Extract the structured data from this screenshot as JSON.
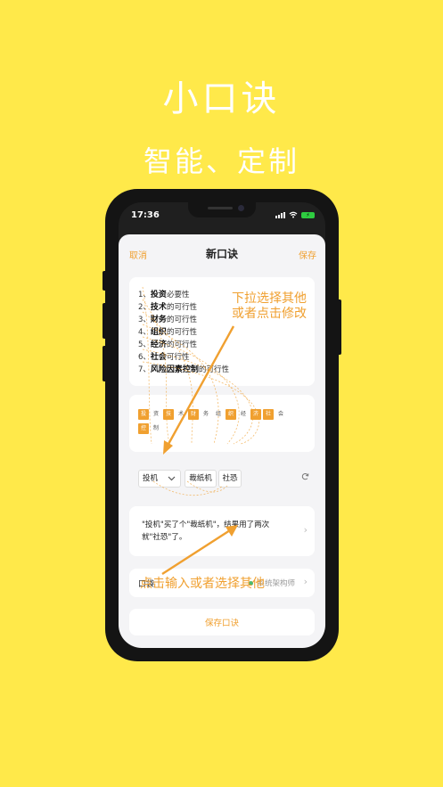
{
  "promo": {
    "title": "小口诀",
    "subtitle": "智能、定制"
  },
  "status_bar": {
    "time": "17:36",
    "battery_icon": "battery-charging-icon"
  },
  "nav": {
    "cancel": "取消",
    "title": "新口诀",
    "save": "保存"
  },
  "items": [
    {
      "num": "1、",
      "bold": "投资",
      "rest": "必要性"
    },
    {
      "num": "2、",
      "bold": "技术",
      "rest": "的可行性"
    },
    {
      "num": "3、",
      "bold": "财务",
      "rest": "的可行性"
    },
    {
      "num": "4、",
      "bold": "组织",
      "rest": "的可行性"
    },
    {
      "num": "5、",
      "bold": "经济",
      "rest": "的可行性"
    },
    {
      "num": "6、",
      "bold": "社会",
      "rest": "可行性"
    },
    {
      "num": "7、",
      "bold": "风险因素控制",
      "rest": "的可行性"
    }
  ],
  "chips": {
    "row1": [
      {
        "ch": "投",
        "on": true
      },
      {
        "ch": "资",
        "on": false
      },
      {
        "ch": "技",
        "on": true
      },
      {
        "ch": "术",
        "on": false
      },
      {
        "ch": "财",
        "on": true
      },
      {
        "ch": "务",
        "on": false
      },
      {
        "ch": "组",
        "on": false
      },
      {
        "ch": "织",
        "on": true
      },
      {
        "ch": "经",
        "on": false
      },
      {
        "ch": "济",
        "on": true
      },
      {
        "ch": "社",
        "on": true
      },
      {
        "ch": "会",
        "on": false
      }
    ],
    "row2": [
      {
        "ch": "控",
        "on": true
      },
      {
        "ch": "制",
        "on": false
      }
    ]
  },
  "slots": {
    "first": "投机",
    "second": "裁纸机",
    "third": "社恐"
  },
  "sentence": {
    "line1": "\"投机\"买了个\"裁纸机\"，结果用了两次",
    "line2": "就\"社恐\"了。"
  },
  "pocket": {
    "label": "口袋",
    "value": "系统架构师",
    "status_color": "#4cba6e"
  },
  "save_button": "保存口诀",
  "annotations": {
    "top": [
      "下拉选择其他",
      "或者点击修改"
    ],
    "bottom": "点击输入或者选择其他"
  },
  "colors": {
    "background": "#ffe94a",
    "accent": "#f0a030"
  }
}
